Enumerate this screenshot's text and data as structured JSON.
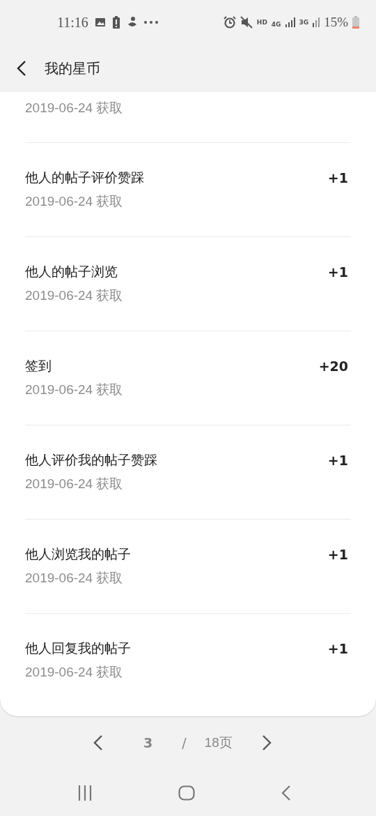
{
  "status_bar": {
    "time": "11:16",
    "network_4g": "4G",
    "network_3g": "3G",
    "hd": "HD",
    "battery": "15%"
  },
  "header": {
    "title": "我的星币"
  },
  "records": [
    {
      "date": "2019-06-24 获取"
    },
    {
      "title": "他人的帖子评价赞踩",
      "date": "2019-06-24 获取",
      "amount": "+1"
    },
    {
      "title": "他人的帖子浏览",
      "date": "2019-06-24 获取",
      "amount": "+1"
    },
    {
      "title": "签到",
      "date": "2019-06-24 获取",
      "amount": "+20"
    },
    {
      "title": "他人评价我的帖子赞踩",
      "date": "2019-06-24 获取",
      "amount": "+1"
    },
    {
      "title": "他人浏览我的帖子",
      "date": "2019-06-24 获取",
      "amount": "+1"
    },
    {
      "title": "他人回复我的帖子",
      "date": "2019-06-24 获取",
      "amount": "+1"
    }
  ],
  "pagination": {
    "current": "3",
    "separator": "/",
    "total": "18页"
  }
}
